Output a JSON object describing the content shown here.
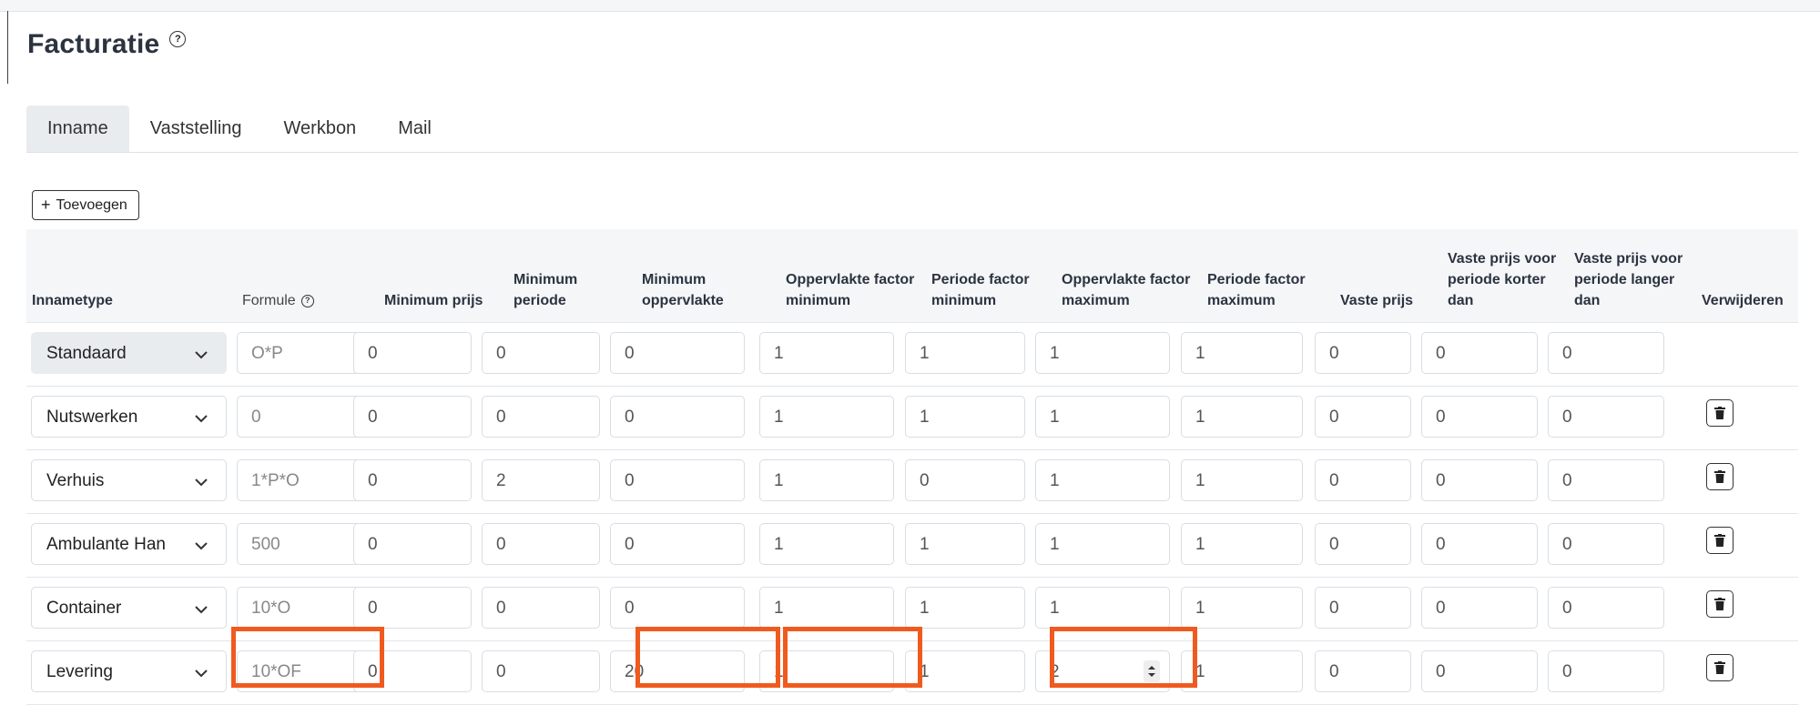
{
  "page": {
    "title": "Facturatie",
    "help_icon": "question-circle-icon"
  },
  "tabs": [
    {
      "label": "Inname",
      "active": true
    },
    {
      "label": "Vaststelling",
      "active": false
    },
    {
      "label": "Werkbon",
      "active": false
    },
    {
      "label": "Mail",
      "active": false
    }
  ],
  "add_button": {
    "icon": "plus-icon",
    "label": "Toevoegen"
  },
  "columns": [
    "Innametype",
    "Formule",
    "Minimum prijs",
    "Minimum periode",
    "Minimum oppervlakte",
    "Oppervlakte factor minimum",
    "Periode factor minimum",
    "Oppervlakte factor maximum",
    "Periode factor maximum",
    "Vaste prijs",
    "Vaste prijs voor periode korter dan",
    "Vaste prijs voor periode langer dan",
    "Verwijderen"
  ],
  "rows": [
    {
      "type": "Standaard",
      "formula": "O*P",
      "values": [
        "0",
        "0",
        "0",
        "1",
        "1",
        "1",
        "1",
        "0",
        "0",
        "0"
      ],
      "deletable": false
    },
    {
      "type": "Nutswerken",
      "formula": "0",
      "values": [
        "0",
        "0",
        "0",
        "1",
        "1",
        "1",
        "1",
        "0",
        "0",
        "0"
      ],
      "deletable": true
    },
    {
      "type": "Verhuis",
      "formula": "1*P*O",
      "values": [
        "0",
        "2",
        "0",
        "1",
        "0",
        "1",
        "1",
        "0",
        "0",
        "0"
      ],
      "deletable": true
    },
    {
      "type": "Ambulante Han",
      "formula": "500",
      "values": [
        "0",
        "0",
        "0",
        "1",
        "1",
        "1",
        "1",
        "0",
        "0",
        "0"
      ],
      "deletable": true
    },
    {
      "type": "Container",
      "formula": "10*O",
      "values": [
        "0",
        "0",
        "0",
        "1",
        "1",
        "1",
        "1",
        "0",
        "0",
        "0"
      ],
      "deletable": true
    },
    {
      "type": "Levering",
      "formula": "10*OF",
      "values": [
        "0",
        "0",
        "20",
        "1",
        "1",
        "2",
        "1",
        "0",
        "0",
        "0"
      ],
      "deletable": true
    }
  ],
  "colors": {
    "highlight": "#f05a1e",
    "header_bg": "#f4f6f8",
    "tab_active_bg": "#e9ecef"
  }
}
